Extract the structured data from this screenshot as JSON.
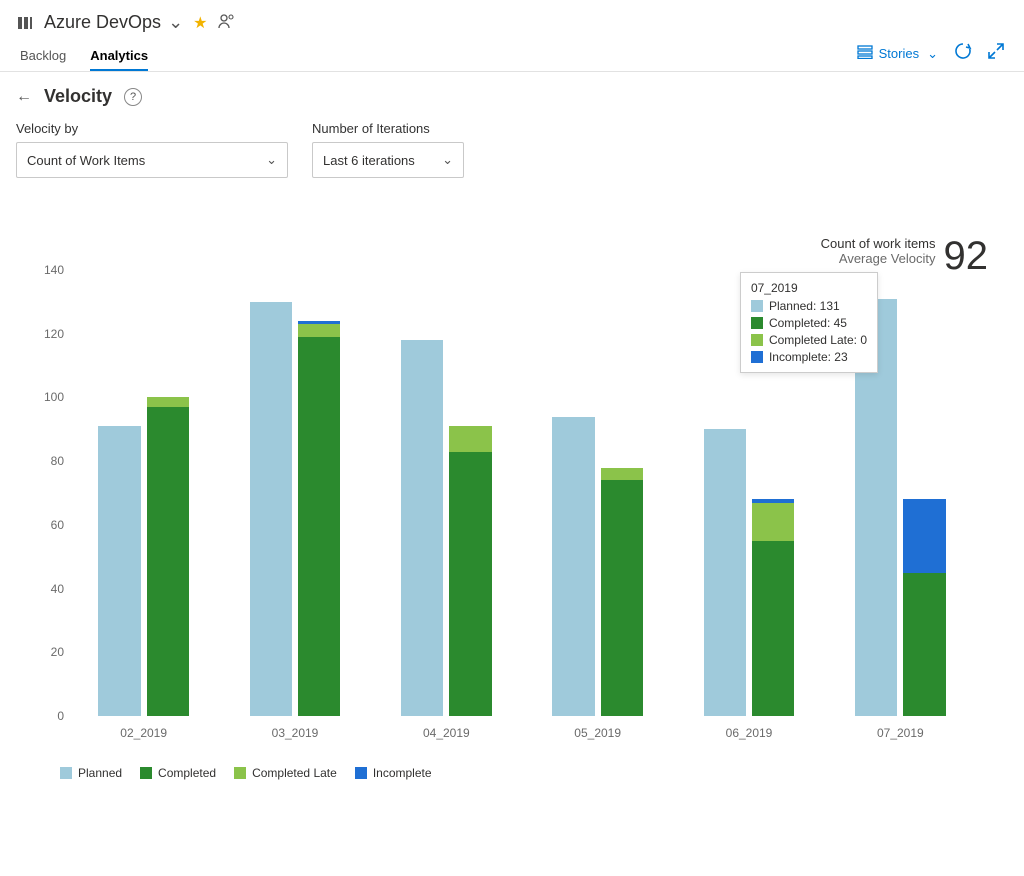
{
  "header": {
    "app_name": "Azure DevOps",
    "tabs": {
      "backlog": "Backlog",
      "analytics": "Analytics"
    },
    "right": {
      "stories_label": "Stories"
    }
  },
  "page": {
    "title": "Velocity",
    "filters": {
      "velocity_by": {
        "label": "Velocity by",
        "value": "Count of Work Items"
      },
      "iterations": {
        "label": "Number of Iterations",
        "value": "Last 6 iterations"
      }
    },
    "metric": {
      "line1": "Count of work items",
      "line2": "Average Velocity",
      "value": "92"
    }
  },
  "tooltip": {
    "title": "07_2019",
    "rows": {
      "planned": "Planned: 131",
      "completed": "Completed: 45",
      "completed_late": "Completed Late: 0",
      "incomplete": "Incomplete: 23"
    }
  },
  "legend": {
    "planned": "Planned",
    "completed": "Completed",
    "completed_late": "Completed Late",
    "incomplete": "Incomplete"
  },
  "colors": {
    "planned": "#9fcadb",
    "completed": "#2b8a2e",
    "completed_late": "#8bc34a",
    "incomplete": "#1f6fd4"
  },
  "chart_data": {
    "type": "bar",
    "ylabel": "",
    "ylim": [
      0,
      140
    ],
    "yticks": [
      0,
      20,
      40,
      60,
      80,
      100,
      120,
      140
    ],
    "categories": [
      "02_2019",
      "03_2019",
      "04_2019",
      "05_2019",
      "06_2019",
      "07_2019"
    ],
    "series": [
      {
        "name": "Planned",
        "values": [
          91,
          130,
          118,
          94,
          90,
          131
        ]
      },
      {
        "name": "Completed",
        "values": [
          97,
          119,
          83,
          74,
          55,
          45
        ]
      },
      {
        "name": "Completed Late",
        "values": [
          3,
          4,
          8,
          4,
          12,
          0
        ]
      },
      {
        "name": "Incomplete",
        "values": [
          0,
          1,
          0,
          0,
          1,
          23
        ]
      }
    ],
    "note": "Second bar per category is a stack of Completed + Completed Late + Incomplete; first bar is Planned alone."
  }
}
